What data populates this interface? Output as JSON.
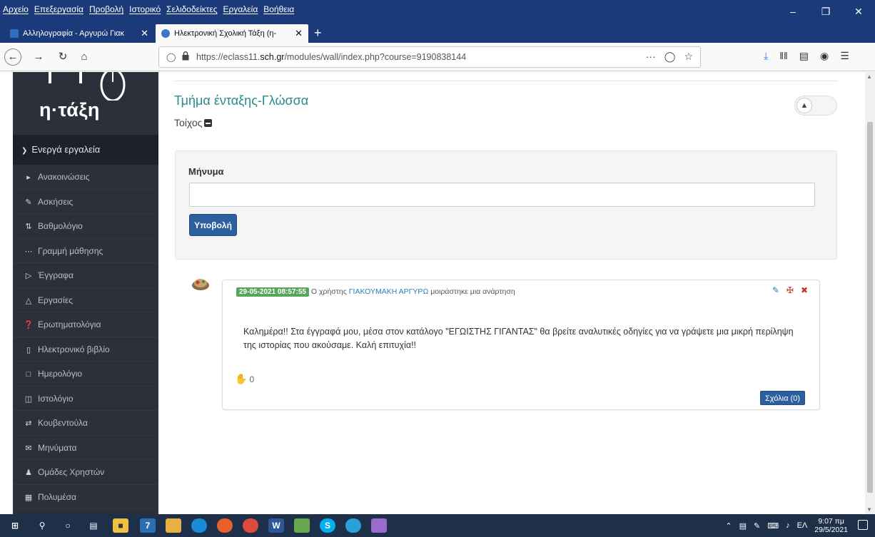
{
  "browser": {
    "menu": [
      "Αρχείο",
      "Επεξεργασία",
      "Προβολή",
      "Ιστορικό",
      "Σελιδοδείκτες",
      "Εργαλεία",
      "Βοήθεια"
    ],
    "tabs": [
      {
        "label": "Αλληλογραφία - Αργυρώ Γιακ"
      },
      {
        "label": "Ηλεκτρονική Σχολική Τάξη (η-"
      }
    ],
    "url_prefix": "https://eclass11.",
    "url_domain": "sch.gr",
    "url_path": "/modules/wall/index.php?course=9190838144"
  },
  "sidebar": {
    "logo_text": "η·τάξη",
    "section_title": "Ενεργά εργαλεία",
    "items": [
      {
        "label": "Ανακοινώσεις",
        "icon": "megaphone-icon"
      },
      {
        "label": "Ασκήσεις",
        "icon": "edit-icon"
      },
      {
        "label": "Βαθμολόγιο",
        "icon": "sort-numeric-icon"
      },
      {
        "label": "Γραμμή μάθησης",
        "icon": "ellipsis-icon"
      },
      {
        "label": "Έγγραφα",
        "icon": "folder-open-icon"
      },
      {
        "label": "Εργασίες",
        "icon": "flask-icon"
      },
      {
        "label": "Ερωτηματολόγια",
        "icon": "question-circle-icon"
      },
      {
        "label": "Ηλεκτρονικό βιβλίο",
        "icon": "book-icon"
      },
      {
        "label": "Ημερολόγιο",
        "icon": "calendar-icon"
      },
      {
        "label": "Ιστολόγιο",
        "icon": "columns-icon"
      },
      {
        "label": "Κουβεντούλα",
        "icon": "exchange-icon"
      },
      {
        "label": "Μηνύματα",
        "icon": "envelope-icon"
      },
      {
        "label": "Ομάδες Χρηστών",
        "icon": "users-icon"
      },
      {
        "label": "Πολυμέσα",
        "icon": "film-icon"
      }
    ]
  },
  "main": {
    "course_title": "Τμήμα ένταξης-Γλώσσα",
    "section": "Τοίχος",
    "message_label": "Μήνυμα",
    "submit_label": "Υποβολή"
  },
  "post": {
    "date": "29-05-2021 08:57:55",
    "meta_prefix": "Ο χρήστης",
    "author": "ΓΙΑΚΟΥΜΑΚΗ ΑΡΓΥΡΩ",
    "meta_suffix": "μοιράστηκε μια ανάρτηση",
    "text": "Καλημέρα!! Στα έγγραφά μου, μέσα στον κατάλογο \"ΕΓΩΙΣΤΗΣ ΓΙΓΑΝΤΑΣ\" θα βρείτε αναλυτικές οδηγίες για να γράψετε μια μικρή περίληψη της ιστορίας που ακούσαμε. Καλή επιτυχία!!",
    "likes": "0",
    "comments_label": "Σχόλια (0)"
  },
  "taskbar": {
    "badge": "7",
    "lang": "ΕΛ",
    "time": "9:07 πμ",
    "date": "29/5/2021"
  },
  "colors": {
    "accent": "#2a8a8a",
    "button": "#2c5f9e",
    "sidebar": "#2b303b",
    "date_badge": "#58a55c"
  }
}
